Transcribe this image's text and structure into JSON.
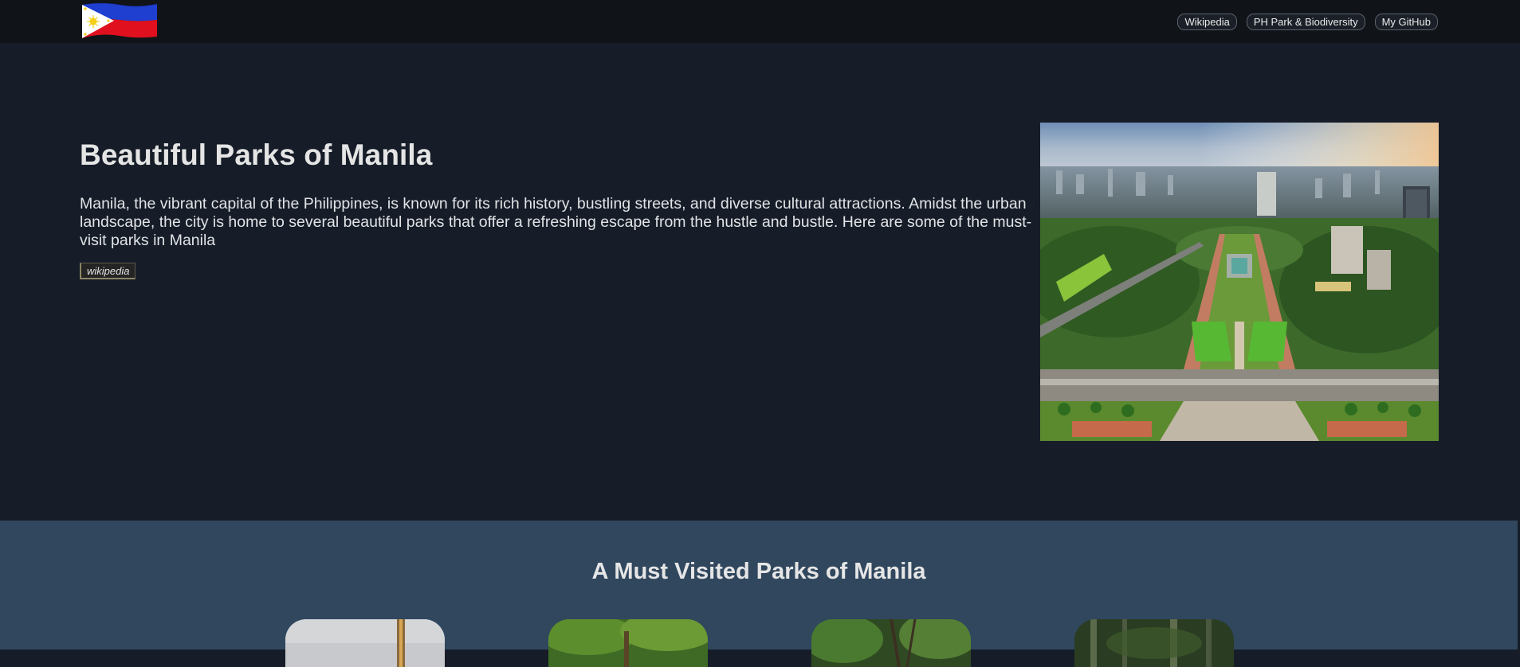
{
  "nav": {
    "logo_alt": "Philippine flag",
    "links": [
      {
        "label": "Wikipedia"
      },
      {
        "label": "PH Park & Biodiversity"
      },
      {
        "label": "My GitHub"
      }
    ]
  },
  "hero": {
    "title": "Beautiful Parks of Manila",
    "description": "Manila, the vibrant capital of the Philippines, is known for its rich history, bustling streets, and diverse cultural attractions. Amidst the urban landscape, the city is home to several beautiful parks that offer a refreshing escape from the hustle and bustle. Here are some of the must-visit parks in Manila",
    "wiki_label": "wikipedia",
    "image_alt": "Aerial view of Rizal Park, Manila"
  },
  "parks": {
    "title": "A Must Visited Parks of Manila",
    "cards": [
      {
        "image": "monument-photo"
      },
      {
        "image": "tree-garden-photo"
      },
      {
        "image": "palm-park-photo"
      },
      {
        "image": "forest-photo"
      }
    ]
  },
  "colors": {
    "topbar": "#101419",
    "page": "#161d28",
    "section": "#30475e",
    "text": "#e5e5e5"
  }
}
